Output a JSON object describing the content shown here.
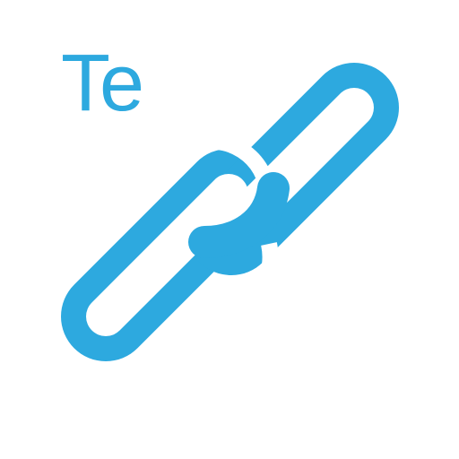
{
  "icon": {
    "name": "chain-link-icon",
    "text": "Te",
    "color": "#2DA9DF",
    "background": "#FFFFFF"
  }
}
